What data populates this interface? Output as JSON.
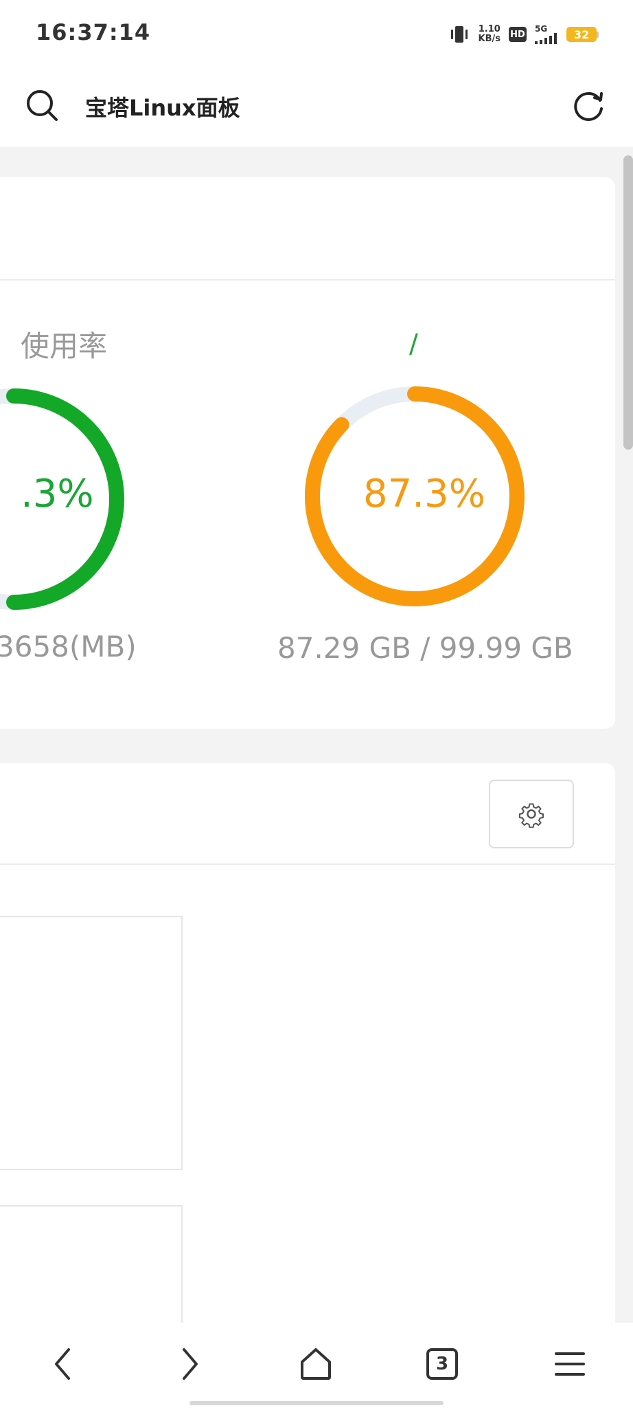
{
  "status_bar": {
    "time": "16:37:14",
    "net_speed_value": "1.10",
    "net_speed_unit": "KB/s",
    "hd_label": "HD",
    "network_label": "5G",
    "battery_level": "32",
    "icons": [
      "vibrate-icon",
      "signal-icon",
      "battery-icon"
    ]
  },
  "browser": {
    "page_title": "宝塔Linux面板",
    "search_icon": "search-icon",
    "reload_icon": "reload-icon"
  },
  "dashboard": {
    "memory": {
      "title": "使用率",
      "percent_text": ".3%",
      "usage_text": "3658(MB)",
      "color": "#13a828"
    },
    "disk": {
      "mount": "/",
      "percent_text": "87.3%",
      "percent_value": 87.3,
      "usage_text": "87.29 GB / 99.99 GB",
      "color": "#f99a0c"
    },
    "panel2": {
      "settings_icon": "gear-icon"
    }
  },
  "bottom_nav": {
    "tab_count": "3",
    "items": [
      "back-icon",
      "forward-icon",
      "home-icon",
      "tabs-icon",
      "menu-icon"
    ]
  }
}
